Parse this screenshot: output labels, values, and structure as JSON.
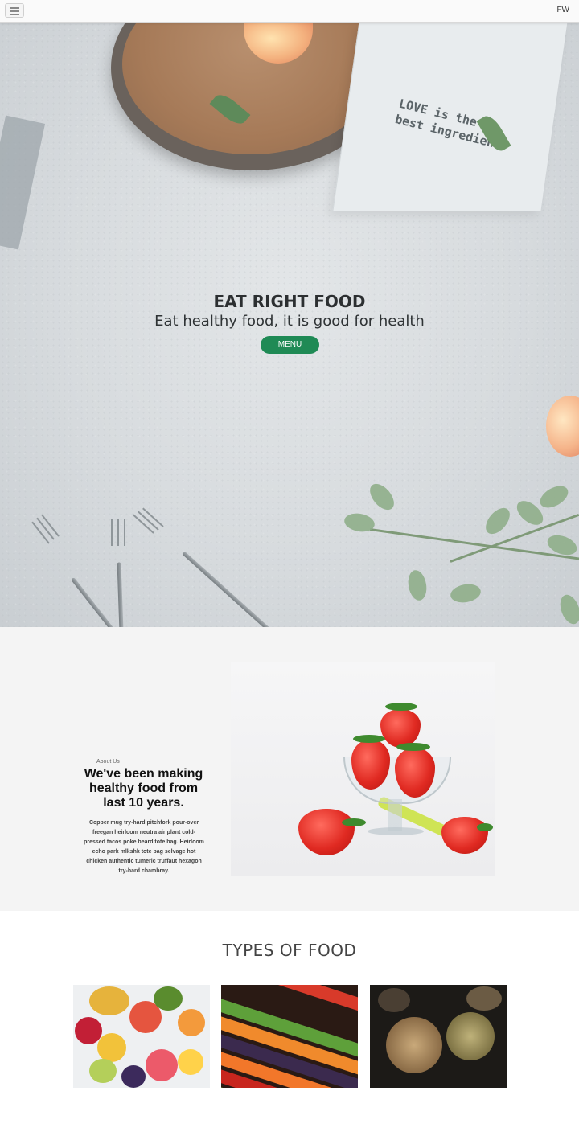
{
  "header": {
    "menu_icon": "hamburger-icon",
    "brand": "FW"
  },
  "hero": {
    "napkin_text_line1": "LOVE is the",
    "napkin_text_line2": "best ingredient",
    "title": "EAT RIGHT FOOD",
    "subtitle": "Eat healthy food, it is good for health",
    "cta_label": "MENU",
    "cta_color": "#1f8a55"
  },
  "about": {
    "label": "About Us",
    "heading": "We've been making healthy food from last 10 years.",
    "body": "Copper mug try-hard pitchfork pour-over freegan heirloom neutra air plant cold-pressed tacos poke beard tote bag. Heirloom echo park mlkshk tote bag selvage hot chicken authentic tumeric truffaut hexagon try-hard chambray."
  },
  "types": {
    "title": "TYPES OF FOOD"
  }
}
